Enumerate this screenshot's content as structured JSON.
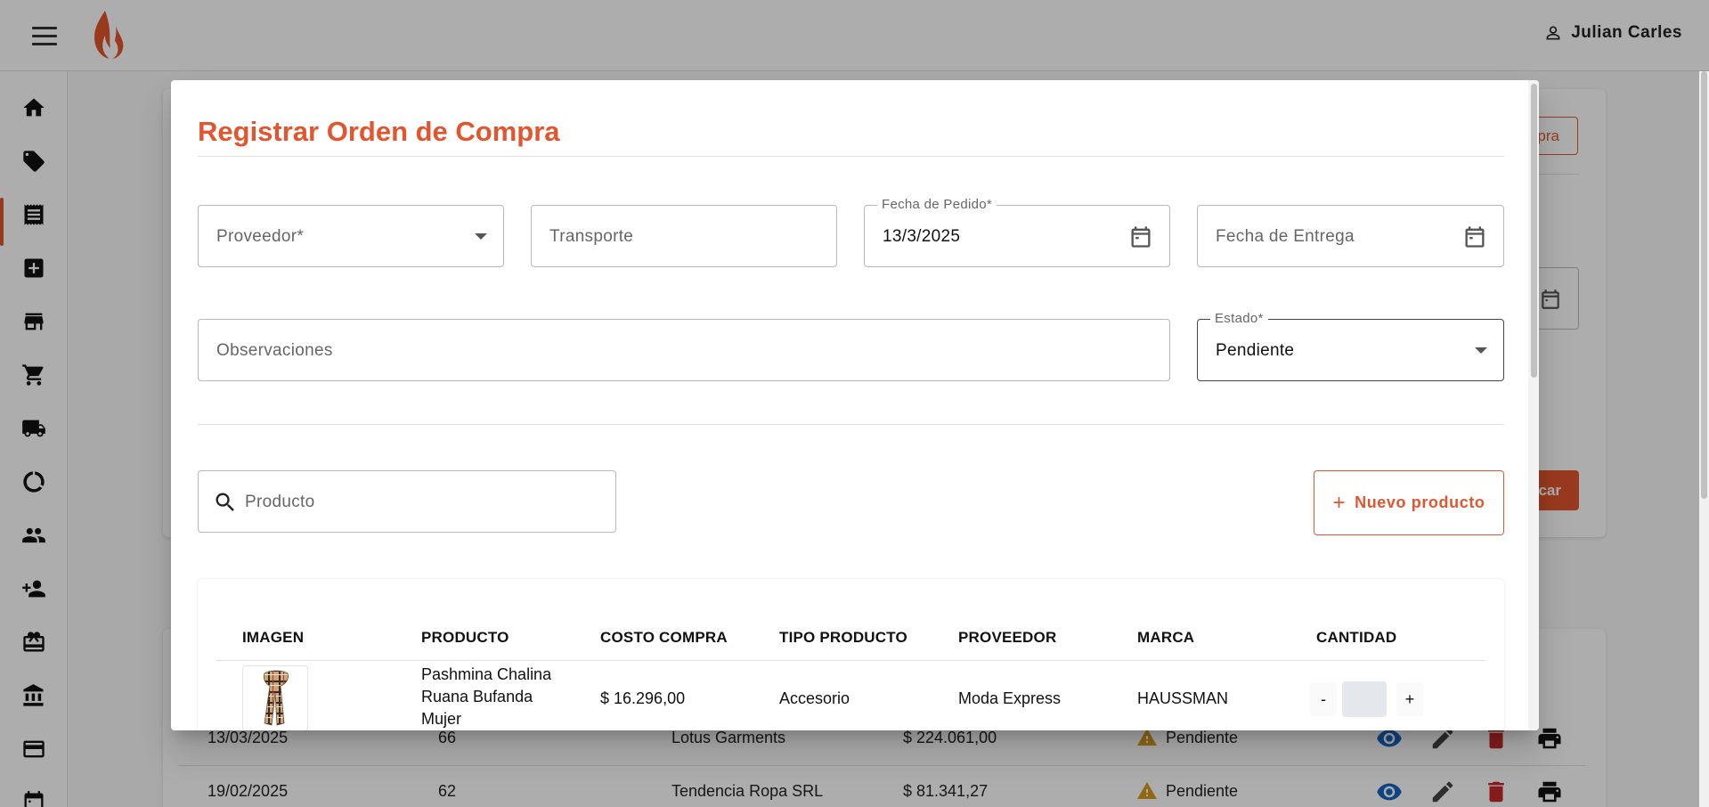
{
  "header": {
    "user_name": "Julian Carles"
  },
  "sidebar": {
    "items": [
      "home-icon",
      "tag-icon",
      "receipt-icon",
      "add-box-icon",
      "store-icon",
      "cart-icon",
      "truck-icon",
      "chart-icon",
      "group-icon",
      "person-add-icon",
      "gift-icon",
      "bank-icon",
      "credit-card-icon",
      "calendar-icon"
    ],
    "active_index": 2
  },
  "background": {
    "outline_button_partial": "pra",
    "filled_button_partial": "car",
    "rows": [
      {
        "date": "13/03/2025",
        "number": "66",
        "supplier": "Lotus Garments",
        "total": "$ 224.061,00",
        "status": "Pendiente"
      },
      {
        "date": "19/02/2025",
        "number": "62",
        "supplier": "Tendencia Ropa SRL",
        "total": "$ 81.341,27",
        "status": "Pendiente"
      }
    ]
  },
  "dialog": {
    "title": "Registrar Orden de Compra",
    "fields": {
      "proveedor": {
        "placeholder": "Proveedor*"
      },
      "transporte": {
        "placeholder": "Transporte"
      },
      "fecha_pedido": {
        "label": "Fecha de Pedido*",
        "value": "13/3/2025"
      },
      "fecha_entrega": {
        "placeholder": "Fecha de Entrega"
      },
      "observaciones": {
        "placeholder": "Observaciones"
      },
      "estado": {
        "label": "Estado*",
        "value": "Pendiente"
      }
    },
    "search": {
      "placeholder": "Producto"
    },
    "new_product_button": "Nuevo producto",
    "table": {
      "headers": [
        "IMAGEN",
        "PRODUCTO",
        "COSTO COMPRA",
        "TIPO PRODUCTO",
        "PROVEEDOR",
        "MARCA",
        "CANTIDAD"
      ],
      "rows": [
        {
          "product_line1": "Pashmina Chalina",
          "product_line2": "Ruana Bufanda",
          "product_line3": "Mujer",
          "cost": "$ 16.296,00",
          "type": "Accesorio",
          "supplier": "Moda Express",
          "brand": "HAUSSMAN",
          "minus": "-",
          "plus": "+"
        }
      ]
    }
  },
  "colors": {
    "accent": "#e2562f",
    "warning": "#d79a1c",
    "view": "#1565c0",
    "delete": "#c62828"
  }
}
